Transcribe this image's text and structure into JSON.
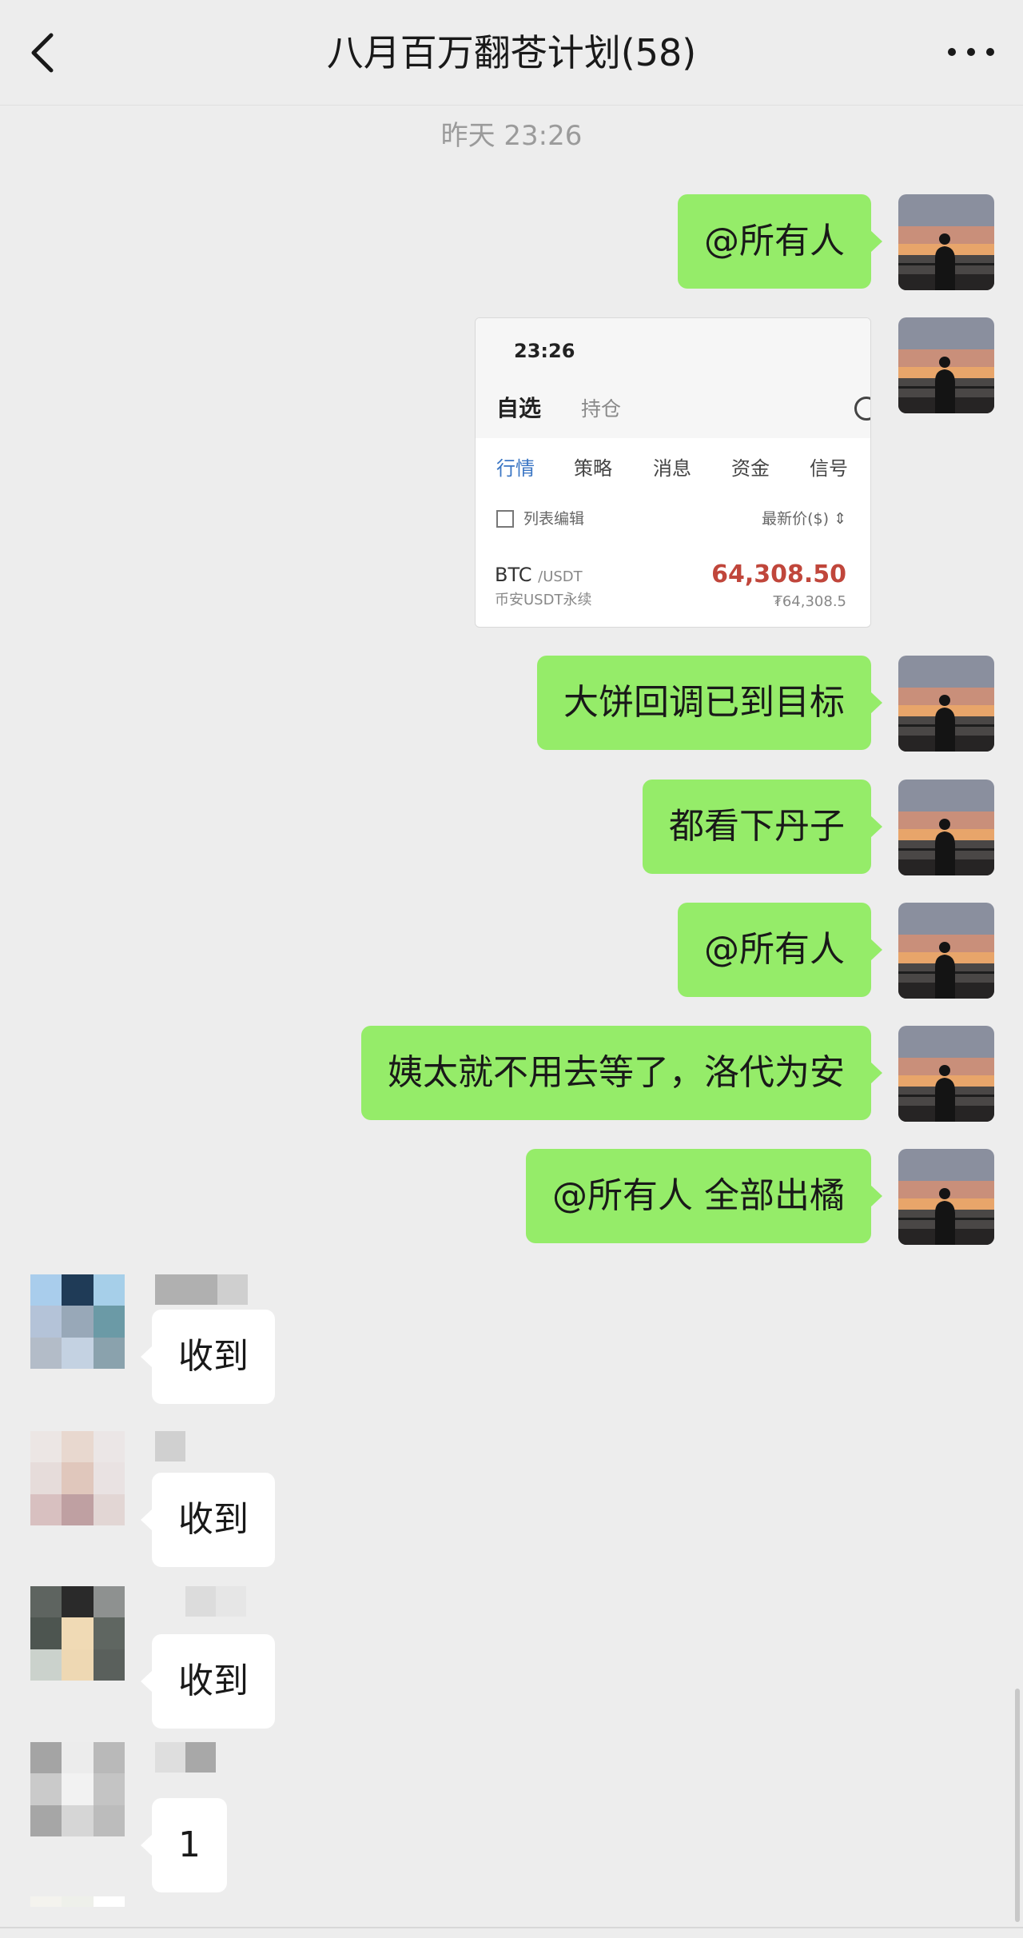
{
  "header": {
    "title": "八月百万翻苍计划(58)",
    "back_icon": "chevron-left-icon",
    "more_icon": "more-dots-icon"
  },
  "timestamp": "昨天 23:26",
  "messages_me": [
    {
      "text": "@所有人"
    },
    {
      "text": "大饼回调已到目标"
    },
    {
      "text": "都看下丹子"
    },
    {
      "text": "@所有人"
    },
    {
      "text": "姨太就不用去等了，洛代为安"
    },
    {
      "text": "@所有人 全部出橘"
    }
  ],
  "screenshot_card": {
    "clock": "23:26",
    "tab_active": "自选",
    "tab_other": "持仓",
    "nav": [
      "行情",
      "策略",
      "消息",
      "资金",
      "信号"
    ],
    "edit_label": "列表编辑",
    "sort_label": "最新价($) ⇕",
    "pair": "BTC",
    "pair_quote": "/USDT",
    "exchange": "币安USDT永续",
    "price": "64,308.50",
    "price_cny": "₮64,308.5"
  },
  "messages_others": [
    {
      "text": "收到"
    },
    {
      "text": "收到"
    },
    {
      "text": "收到"
    },
    {
      "text": "1"
    }
  ],
  "colors": {
    "background": "#ededed",
    "my_bubble": "#95ec69",
    "other_bubble": "#ffffff",
    "price_red": "#c0463b",
    "nav_active_blue": "#3b76c4"
  }
}
